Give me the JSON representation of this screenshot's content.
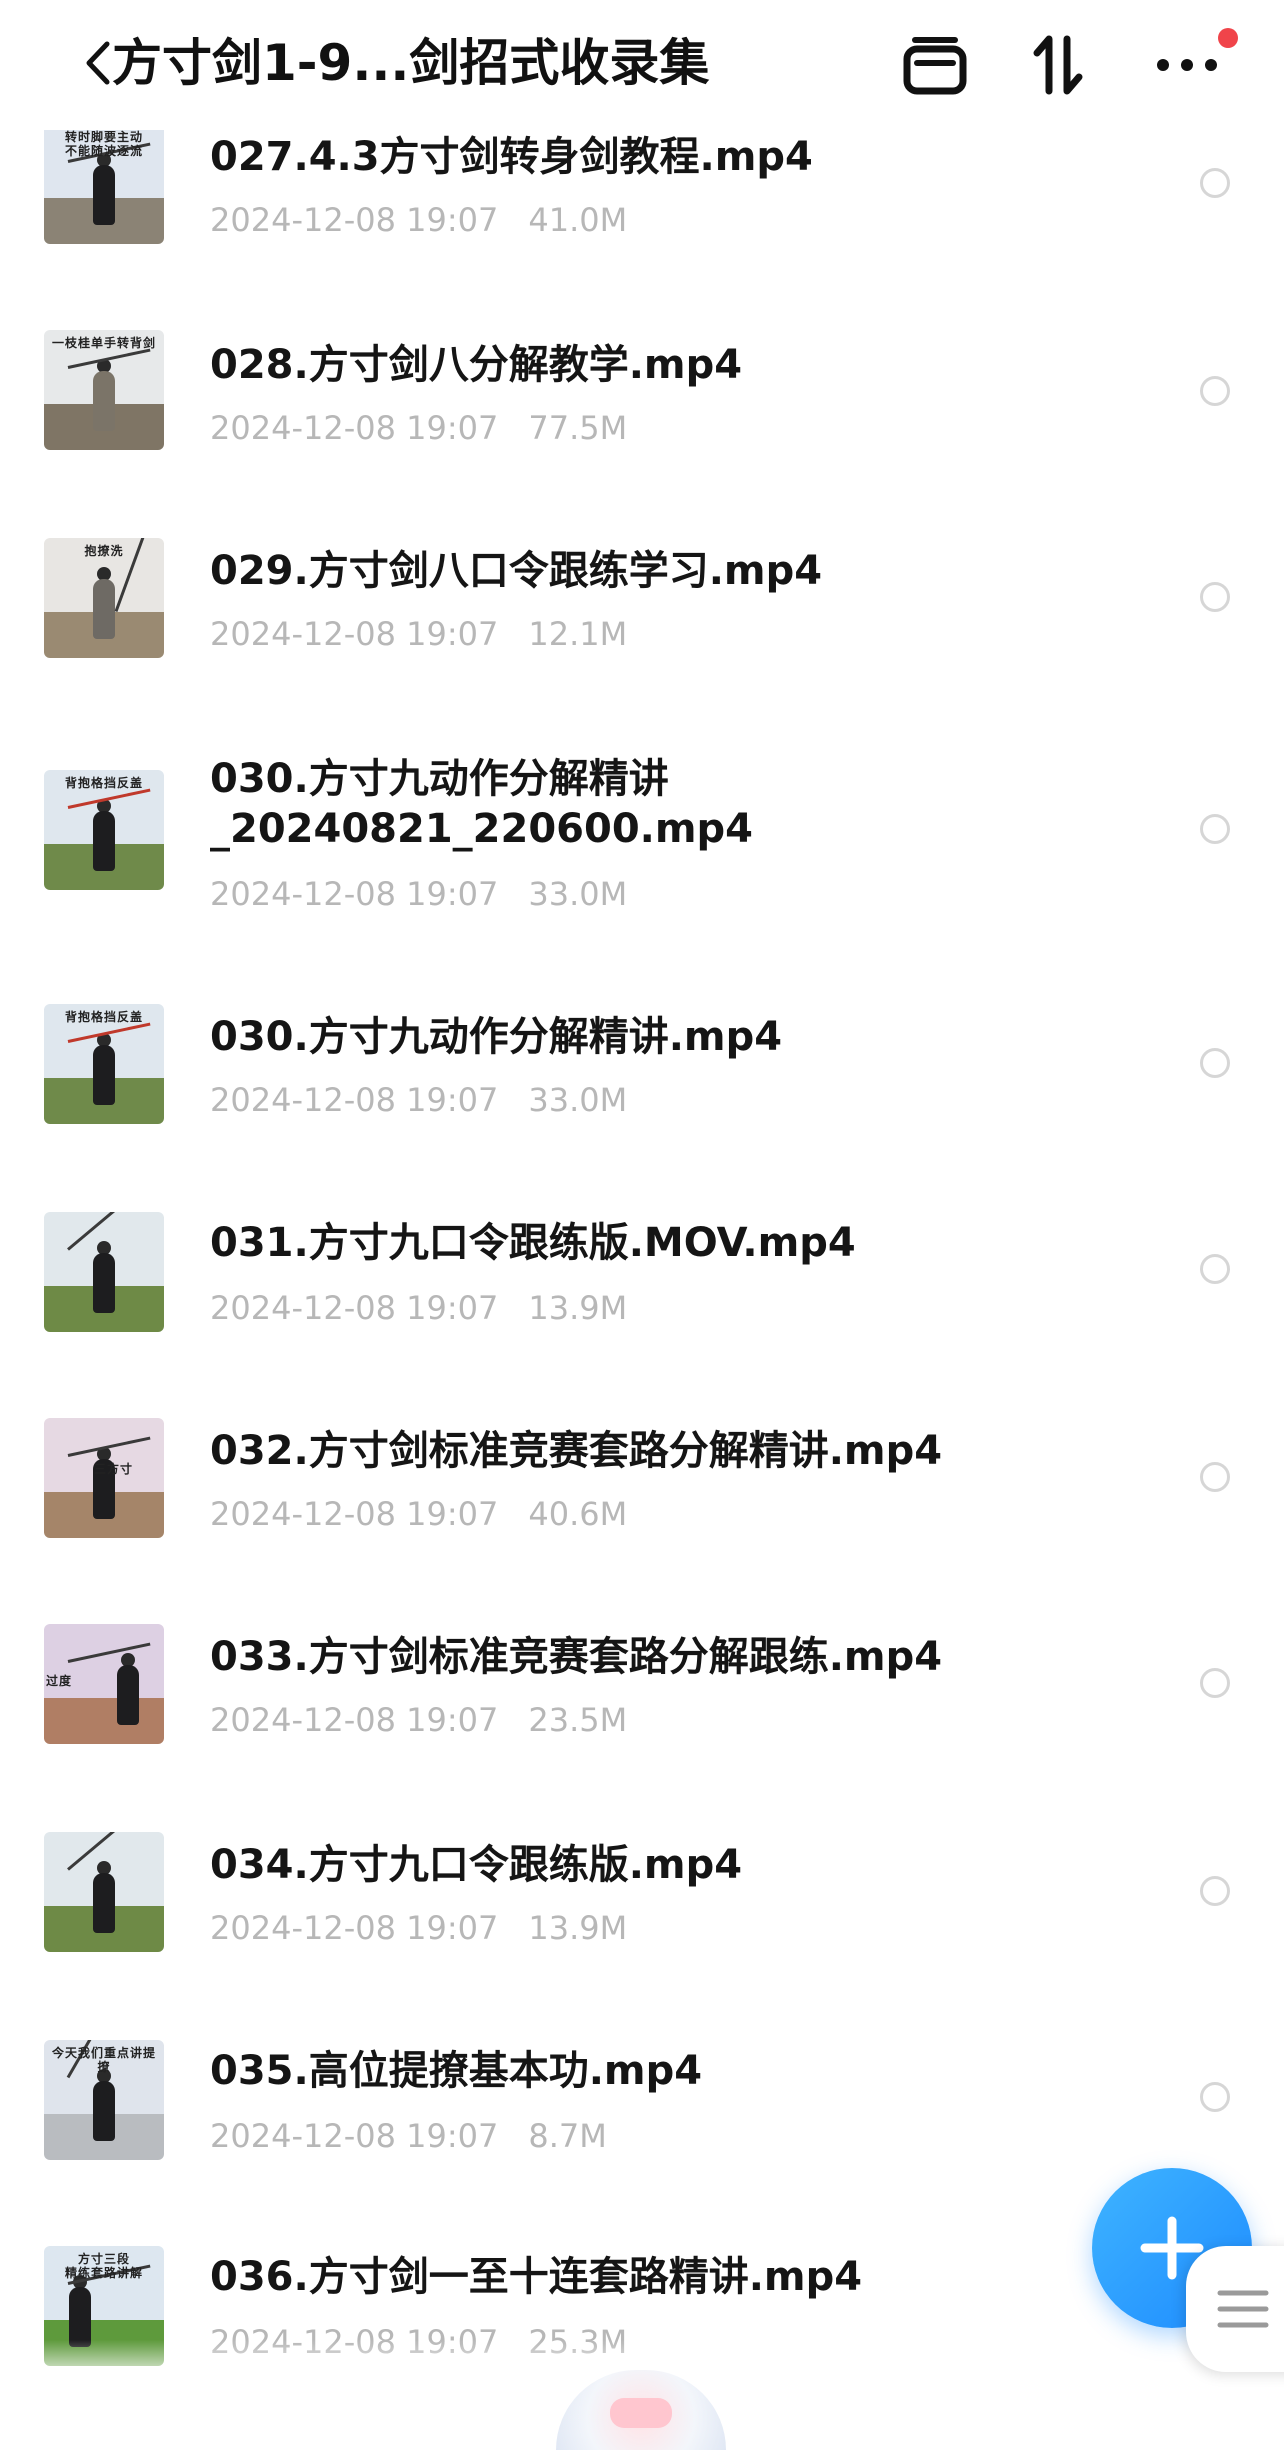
{
  "header": {
    "title": "方寸剑1-9...剑招式收录集",
    "icons": [
      "back-icon",
      "window-icon",
      "sort-icon",
      "more-icon"
    ],
    "badge_color": "#f0444a"
  },
  "files": [
    {
      "name": "027.4.3方寸剑转身剑教程.mp4",
      "date": "2024-12-08 19:07",
      "size": "41.0M",
      "thumb_caption": "转时脚要主动\n不能随波逐流"
    },
    {
      "name": "028.方寸剑八分解教学.mp4",
      "date": "2024-12-08 19:07",
      "size": "77.5M",
      "thumb_caption": "一枝桂单手转背剑"
    },
    {
      "name": "029.方寸剑八口令跟练学习.mp4",
      "date": "2024-12-08 19:07",
      "size": "12.1M",
      "thumb_caption": "抱撩洗"
    },
    {
      "name": "030.方寸九动作分解精讲",
      "name2": "_20240821_220600.mp4",
      "date": "2024-12-08 19:07",
      "size": "33.0M",
      "thumb_caption": "背抱格挡反盖"
    },
    {
      "name": "030.方寸九动作分解精讲.mp4",
      "date": "2024-12-08 19:07",
      "size": "33.0M",
      "thumb_caption": "背抱格挡反盖"
    },
    {
      "name": "031.方寸九口令跟练版.MOV.mp4",
      "date": "2024-12-08 19:07",
      "size": "13.9M",
      "thumb_caption": ""
    },
    {
      "name": "032.方寸剑标准竞赛套路分解精讲.mp4",
      "date": "2024-12-08 19:07",
      "size": "40.6M",
      "thumb_caption": "三方寸"
    },
    {
      "name": "033.方寸剑标准竞赛套路分解跟练.mp4",
      "date": "2024-12-08 19:07",
      "size": "23.5M",
      "thumb_caption": "过度"
    },
    {
      "name": "034.方寸九口令跟练版.mp4",
      "date": "2024-12-08 19:07",
      "size": "13.9M",
      "thumb_caption": ""
    },
    {
      "name": "035.高位提撩基本功.mp4",
      "date": "2024-12-08 19:07",
      "size": "8.7M",
      "thumb_caption": "今天我们重点讲提撩"
    },
    {
      "name": "036.方寸剑一至十连套路精讲.mp4",
      "date": "2024-12-08 19:07",
      "size": "25.3M",
      "thumb_caption": "方寸三段\n精练套路讲解"
    }
  ],
  "fab": {
    "icon": "plus-icon",
    "color": "#1d8bff"
  },
  "side_handle": {
    "icon": "menu-icon"
  }
}
